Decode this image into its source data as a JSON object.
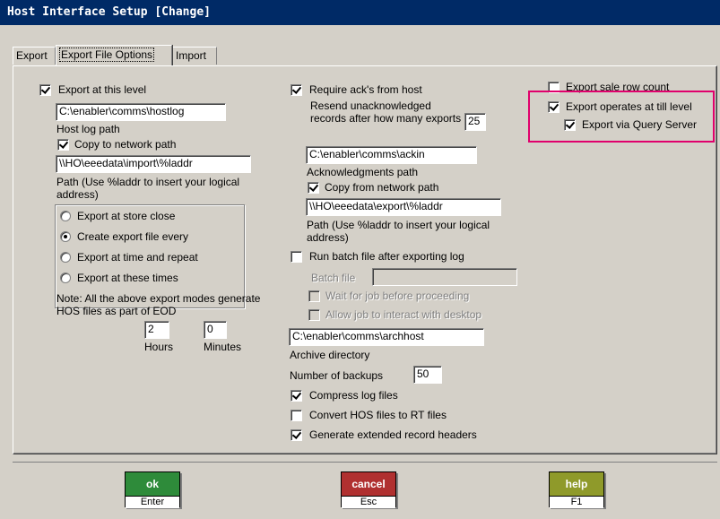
{
  "window": {
    "title": "Host Interface Setup  [Change]"
  },
  "tabs": [
    {
      "label": "Export"
    },
    {
      "label": "Export File Options"
    },
    {
      "label": "Import"
    }
  ],
  "left": {
    "export_at_level": "Export at this level",
    "host_log_path_value": "C:\\enabler\\comms\\hostlog",
    "host_log_path_label": "Host log path",
    "copy_to_network": "Copy to network path",
    "network_path_value": "\\\\HO\\eeedata\\import\\%laddr",
    "network_path_hint": "Path (Use %laddr to insert your logical address)",
    "radios": [
      {
        "label": "Export at store close",
        "checked": false
      },
      {
        "label": "Create export file every",
        "checked": true
      },
      {
        "label": "Export at time and repeat",
        "checked": false
      },
      {
        "label": "Export at these times",
        "checked": false
      }
    ],
    "note": "Note: All the above export modes generate HOS files as part of EOD",
    "hours_value": "2",
    "minutes_value": "0",
    "hours_label": "Hours",
    "minutes_label": "Minutes"
  },
  "middle": {
    "require_ack": "Require ack's from host",
    "resend_label": "Resend unacknowledged records after how many exports",
    "resend_value": "25",
    "ack_path_value": "C:\\enabler\\comms\\ackin",
    "ack_path_label": "Acknowledgments path",
    "copy_from_network": "Copy from network path",
    "network_path_value": "\\\\HO\\eeedata\\export\\%laddr",
    "network_path_hint": "Path (Use %laddr to insert your logical address)",
    "run_batch": "Run batch file after exporting log",
    "batch_file_label": "Batch file",
    "batch_file_value": "",
    "wait_for_job": "Wait for job before proceeding",
    "allow_job": "Allow job to interact with desktop",
    "archive_value": "C:\\enabler\\comms\\archhost",
    "archive_label": "Archive directory",
    "backups_label": "Number of backups",
    "backups_value": "50",
    "compress": "Compress log files",
    "convert": "Convert HOS files to RT files",
    "extended": "Generate extended record headers"
  },
  "right": {
    "sale_row_count": "Export sale row count",
    "till_level": "Export operates at till level",
    "query_server": "Export via Query Server"
  },
  "buttons": {
    "ok": {
      "label": "ok",
      "key": "Enter",
      "color": "#2e8b3a"
    },
    "cancel": {
      "label": "cancel",
      "key": "Esc",
      "color": "#b03030"
    },
    "help": {
      "label": "help",
      "key": "F1",
      "color": "#8f9a2a"
    }
  },
  "colors": {
    "titlebar": "#002a66",
    "highlight": "#e0006c"
  }
}
